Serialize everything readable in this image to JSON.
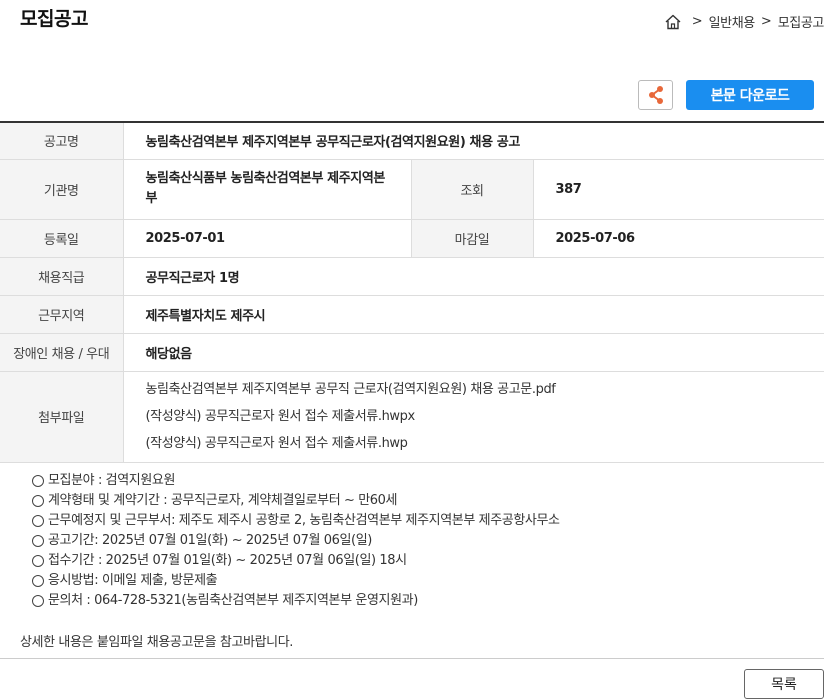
{
  "header": {
    "title": "모집공고",
    "breadcrumb": [
      "일반채용",
      "모집공고"
    ],
    "breadcrumb_sep": ">"
  },
  "toolbar": {
    "download_label": "본문 다운로드",
    "share_icon": "share-icon",
    "accent_color": "#1a8ef0",
    "share_color": "#e8683a"
  },
  "info": {
    "announcement_label": "공고명",
    "announcement_value": "농림축산검역본부 제주지역본부 공무직근로자(검역지원요원) 채용 공고",
    "org_label": "기관명",
    "org_value": "농림축산식품부 농림축산검역본부 제주지역본부",
    "views_label": "조회",
    "views_value": "387",
    "reg_label": "등록일",
    "reg_value": "2025-07-01",
    "deadline_label": "마감일",
    "deadline_value": "2025-07-06",
    "position_label": "채용직급",
    "position_value": "공무직근로자 1명",
    "region_label": "근무지역",
    "region_value": "제주특별자치도 제주시",
    "disability_label": "장애인 채용 / 우대",
    "disability_value": "해당없음",
    "attach_label": "첨부파일",
    "attachments": [
      "농림축산검역본부 제주지역본부 공무직 근로자(검역지원요원) 채용 공고문.pdf",
      "(작성양식) 공무직근로자 원서 접수 제출서류.hwpx",
      "(작성양식) 공무직근로자 원서 접수 제출서류.hwp"
    ]
  },
  "body": {
    "items": [
      "모집분야 : 검역지원요원",
      "계약형태 및 계약기간  : 공무직근로자, 계약체결일로부터 ~ 만60세",
      "근무예정지 및 근무부서: 제주도 제주시 공항로 2, 농림축산검역본부 제주지역본부 제주공항사무소",
      "공고기간:  2025년 07월 01일(화) ~ 2025년 07월  06일(일)",
      "접수기간 : 2025년 07월 01일(화) ~ 2025년 07월  06일(일) 18시",
      "응시방법: 이메일 제출, 방문제출",
      "문의처 : 064-728-5321(농림축산검역본부 제주지역본부 운영지원과)"
    ],
    "note": "상세한 내용은 붙임파일 채용공고문을 참고바랍니다."
  },
  "footer": {
    "list_label": "목록"
  }
}
